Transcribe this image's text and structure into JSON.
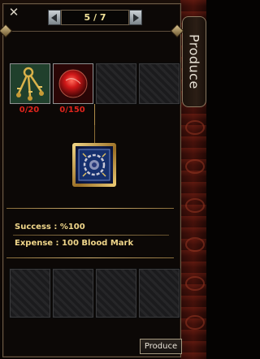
{
  "header": {
    "close_symbol": "✕",
    "page_indicator": "5 / 7"
  },
  "side_tab": {
    "label": "Produce"
  },
  "materials": [
    {
      "icon": "golden-keys-icon",
      "count": "0/20"
    },
    {
      "icon": "red-orb-icon",
      "count": "0/150"
    },
    {
      "icon": "empty-slot",
      "count": ""
    },
    {
      "icon": "empty-slot",
      "count": ""
    }
  ],
  "result": {
    "icon": "blue-seal-scroll-icon"
  },
  "info": {
    "success": "Success : %100",
    "expense": "Expense : 100 Blood Mark"
  },
  "output_slots": [
    {
      "icon": "empty-slot"
    },
    {
      "icon": "empty-slot"
    },
    {
      "icon": "empty-slot"
    },
    {
      "icon": "empty-slot"
    }
  ],
  "actions": {
    "produce_label": "Produce"
  },
  "colors": {
    "count_red": "#e0241c",
    "info_gold": "#f0d68a",
    "page_yellow": "#f3e39a",
    "frame_gold": "#d2b170"
  }
}
